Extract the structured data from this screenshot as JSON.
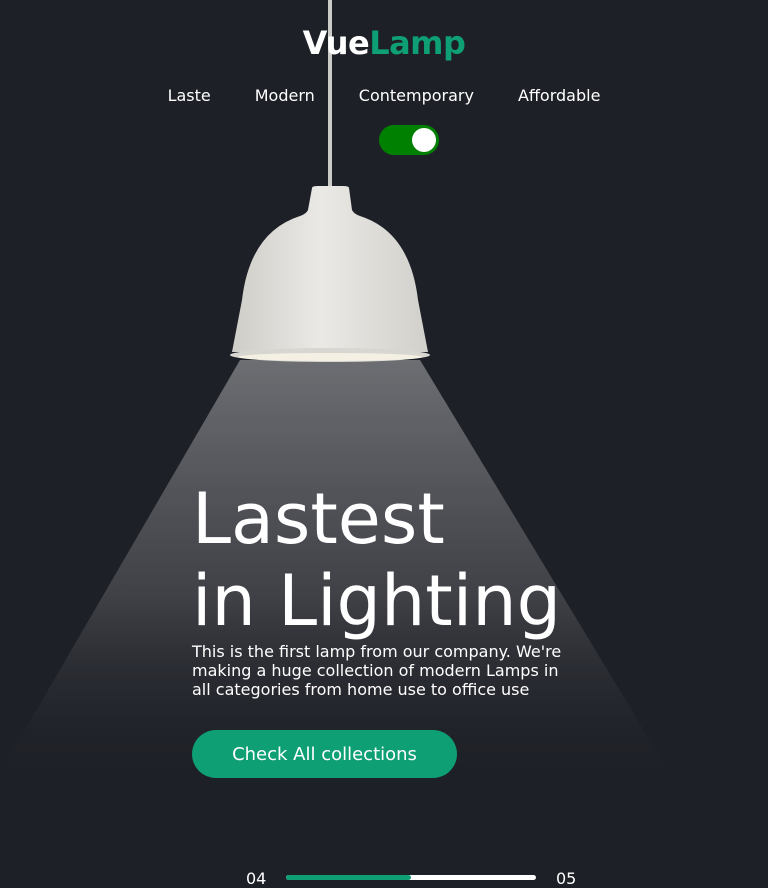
{
  "brand": {
    "part1": "Vue",
    "part2": "Lamp"
  },
  "nav": {
    "items": [
      {
        "label": "Laste"
      },
      {
        "label": "Modern"
      },
      {
        "label": "Contemporary"
      },
      {
        "label": "Affordable"
      }
    ]
  },
  "light_toggle": {
    "on": true,
    "on_color": "#008000"
  },
  "hero": {
    "title_line1": "Lastest",
    "title_line2": "in Lighting",
    "description": "This is the first lamp from our company. We're making a huge collection of modern Lamps in all categories from home use to office use",
    "cta_label": "Check All collections"
  },
  "slider": {
    "current": "04",
    "total": "05",
    "progress": 0.5
  },
  "colors": {
    "background": "#1e2027",
    "accent": "#0e9f74",
    "text": "#ffffff",
    "lamp_shade": "#e6e4e0"
  },
  "icons": {
    "lamp": "pendant-lamp-icon"
  }
}
